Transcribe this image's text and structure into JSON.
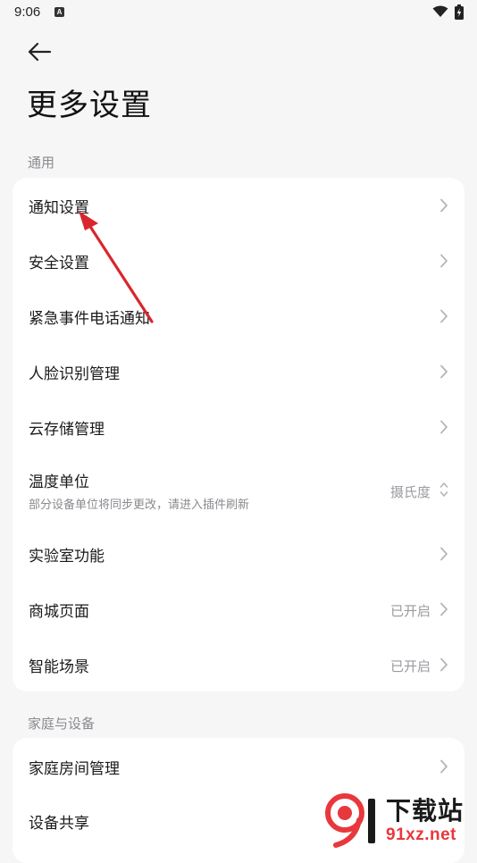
{
  "status_bar": {
    "time": "9:06",
    "app_icon_glyph": "A",
    "icons": [
      "wifi-icon",
      "battery-charging-icon"
    ]
  },
  "header": {
    "back_icon": "arrow-left-icon",
    "title": "更多设置"
  },
  "sections": [
    {
      "header": "通用",
      "items": [
        {
          "label": "通知设置",
          "value": "",
          "chevron": "chevron-right"
        },
        {
          "label": "安全设置",
          "value": "",
          "chevron": "chevron-right"
        },
        {
          "label": "紧急事件电话通知",
          "value": "",
          "chevron": "chevron-right"
        },
        {
          "label": "人脸识别管理",
          "value": "",
          "chevron": "chevron-right"
        },
        {
          "label": "云存储管理",
          "value": "",
          "chevron": "chevron-right"
        },
        {
          "label": "温度单位",
          "subtitle": "部分设备单位将同步更改，请进入插件刷新",
          "value": "摄氏度",
          "chevron": "chevron-up-down"
        },
        {
          "label": "实验室功能",
          "value": "",
          "chevron": "chevron-right"
        },
        {
          "label": "商城页面",
          "value": "已开启",
          "chevron": "chevron-right"
        },
        {
          "label": "智能场景",
          "value": "已开启",
          "chevron": "chevron-right"
        }
      ]
    },
    {
      "header": "家庭与设备",
      "items": [
        {
          "label": "家庭房间管理",
          "value": "",
          "chevron": "chevron-right"
        },
        {
          "label": "设备共享",
          "value": "",
          "chevron": "chevron-right"
        }
      ]
    }
  ],
  "watermark": {
    "text_top": "下载站",
    "text_bottom": "91xz.net",
    "logo_glyph": "9"
  },
  "colors": {
    "background": "#f6f6f7",
    "card": "#ffffff",
    "annotation_arrow": "#d9262c",
    "watermark_red": "#e8383d"
  }
}
